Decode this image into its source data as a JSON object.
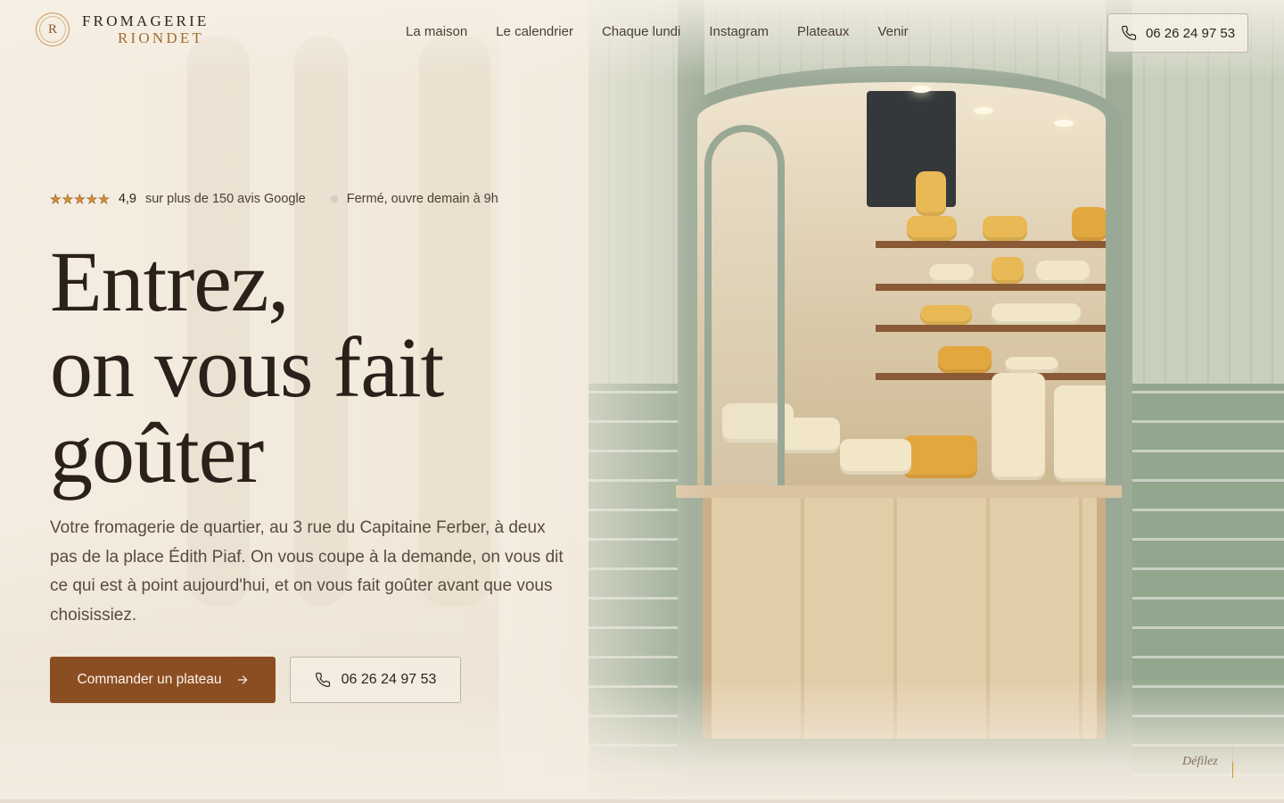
{
  "brand": {
    "monogram": "R",
    "name_line1": "FROMAGERIE",
    "name_line2": "RIONDET"
  },
  "nav": {
    "items": [
      {
        "label": "La maison"
      },
      {
        "label": "Le calendrier"
      },
      {
        "label": "Chaque lundi"
      },
      {
        "label": "Instagram"
      },
      {
        "label": "Plateaux"
      },
      {
        "label": "Venir"
      }
    ]
  },
  "header_phone": {
    "label": "06 26 24 97 53",
    "icon": "phone-icon"
  },
  "rating": {
    "stars": 5,
    "score": "4,9",
    "reviews_text": "sur plus de 150 avis Google",
    "star_color": "#d9932e"
  },
  "status": {
    "text": "Fermé, ouvre demain à 9h"
  },
  "hero": {
    "title_line1": "Entrez,",
    "title_line2": "on vous fait",
    "title_line3": "goûter",
    "lead": "Votre fromagerie de quartier, au 3 rue du Capitaine Ferber, à deux pas de la place Édith Piaf. On vous coupe à la demande, on vous dit ce qui est à point aujourd'hui, et on vous fait goûter avant que vous choisissiez."
  },
  "cta": {
    "primary_label": "Commander un plateau",
    "primary_icon": "arrow-right-icon",
    "secondary_label": "06 26 24 97 53",
    "secondary_icon": "phone-icon"
  },
  "scroll_hint": {
    "label": "Défilez"
  },
  "colors": {
    "accent": "#8b4e22",
    "background": "#f5efe4",
    "text": "#2b211a",
    "gold": "#a56b2d"
  }
}
